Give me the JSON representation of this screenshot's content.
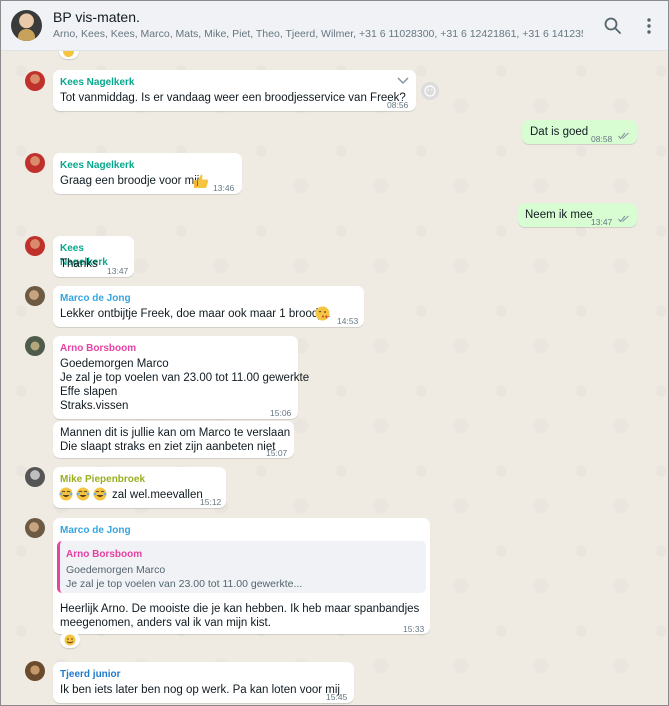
{
  "header": {
    "title": "BP vis-maten.",
    "members": "Arno, Kees, Kees, Marco, Mats, Mike, Piet, Theo, Tjeerd, Wilmer, +31 6 11028300, +31 6 12421861, +31 6 14123560, ..."
  },
  "messages": [
    {
      "sender": "Kees Nagelkerk",
      "text": "Tot vanmiddag. Is er vandaag weer een broodjesservice van Freek?",
      "time": "08:56"
    },
    {
      "text": "Dat is goed",
      "time": "08:58"
    },
    {
      "sender": "Kees Nagelkerk",
      "text": "Graag een broodje voor mij",
      "time": "13:46"
    },
    {
      "text": "Neem ik mee",
      "time": "13:47"
    },
    {
      "sender": "Kees Nagelkerk",
      "text": "Thanks",
      "time": "13:47"
    },
    {
      "sender": "Marco de Jong",
      "text": "Lekker ontbijtje Freek, doe maar ook maar 1 broodje.",
      "time": "14:53"
    },
    {
      "sender": "Arno Borsboom",
      "lines": [
        "Goedemorgen Marco",
        "Je zal je top voelen van 23.00 tot 11.00 gewerkte",
        "Effe slapen",
        "Straks.vissen"
      ],
      "time": "15:06"
    },
    {
      "lines": [
        "Mannen dit is jullie kan om Marco te verslaan",
        "Die slaapt straks en ziet zijn aanbeten niet"
      ],
      "time": "15:07"
    },
    {
      "sender": "Mike Piepenbroek",
      "text": "zal wel.meevallen",
      "time": "15:12"
    },
    {
      "sender": "Marco de Jong",
      "quote": {
        "sender": "Arno Borsboom",
        "line1": "Goedemorgen Marco",
        "line2": "Je zal je top voelen van 23.00 tot 11.00 gewerkte..."
      },
      "lines": [
        "Heerlijk Arno. De mooiste die je kan hebben. Ik heb maar spanbandjes",
        "meegenomen, anders val ik van mijn kist."
      ],
      "time": "15:33"
    },
    {
      "sender": "Tjeerd junior",
      "text": "Ik ben iets later ben nog op werk. Pa kan loten voor mij",
      "time": "15:45"
    }
  ],
  "colors": {
    "kees": "#06a88b",
    "marco": "#35a6e0",
    "arno": "#e542a3",
    "mike": "#9aae1f",
    "tjeerd": "#1f7acc",
    "outgoing_bubble": "#d9fdd3",
    "chat_bg": "#efeae2"
  },
  "icons": {
    "search": "search-icon",
    "menu": "menu-icon",
    "chevron": "chevron-down-icon",
    "emoji_react": "emoji-react-icon"
  }
}
